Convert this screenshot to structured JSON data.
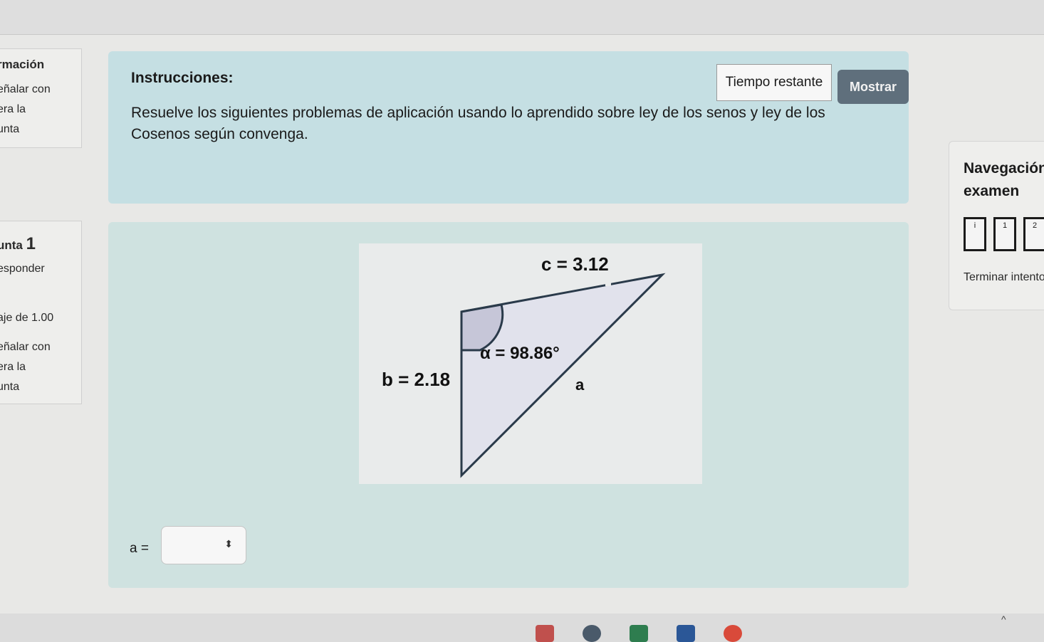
{
  "left_info": {
    "top_lines": [
      "rmación",
      "eñalar con",
      "era la",
      "unta"
    ],
    "q_title_prefix": "unta",
    "q_number": "1",
    "status": "esponder",
    "grade": "aje de 1.00",
    "flag_lines": [
      "eñalar con",
      "era la",
      "unta"
    ]
  },
  "instructions": {
    "title": "Instrucciones:",
    "body": "Resuelve los siguientes problemas de aplicación usando lo aprendido sobre ley de los senos y ley de los Cosenos según convenga."
  },
  "timer": {
    "label": "Tiempo restante",
    "button": "Mostrar"
  },
  "figure": {
    "side_c": "c = 3.12",
    "side_b": "b = 2.18",
    "angle": "α = 98.86°",
    "side_a": "a"
  },
  "answer": {
    "label": "a ="
  },
  "navigation": {
    "title_line1": "Navegación",
    "title_line2": "examen",
    "cells": [
      "i",
      "1",
      "2"
    ],
    "finish": "Terminar intento"
  },
  "taskbar": {
    "icons": [
      "app-icon",
      "app-icon",
      "excel-icon",
      "word-icon",
      "chrome-icon"
    ]
  }
}
